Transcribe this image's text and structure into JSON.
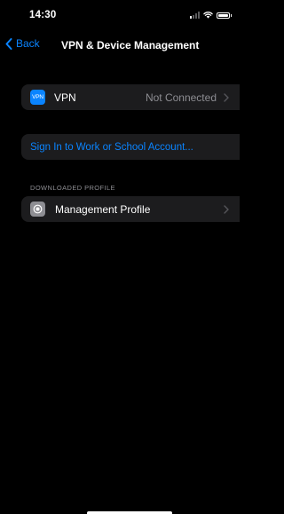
{
  "status_bar": {
    "time": "14:30"
  },
  "nav": {
    "back_label": "Back",
    "title": "VPN & Device Management"
  },
  "vpn_row": {
    "badge": "VPN",
    "label": "VPN",
    "value": "Not Connected",
    "icon": "vpn-icon"
  },
  "sign_in": {
    "label": "Sign In to Work or School Account..."
  },
  "downloaded_profile": {
    "header": "DOWNLOADED PROFILE",
    "label": "Management Profile",
    "icon": "settings-gear-icon"
  },
  "colors": {
    "accent": "#0a84ff",
    "cell_bg": "#1c1c1e",
    "secondary_text": "#8d8d92"
  }
}
